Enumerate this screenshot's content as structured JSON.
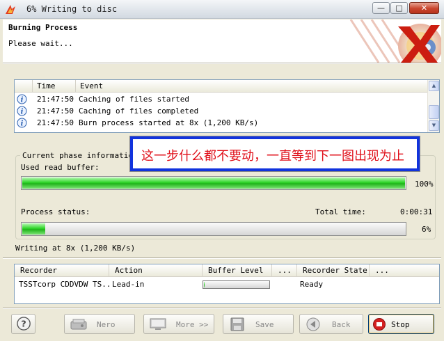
{
  "window": {
    "title": "6% Writing to disc"
  },
  "header": {
    "title": "Burning Process",
    "subtitle": "Please wait..."
  },
  "log": {
    "columns": [
      "Time",
      "Event"
    ],
    "rows": [
      {
        "time": "21:47:50",
        "event": "Caching of files started"
      },
      {
        "time": "21:47:50",
        "event": "Caching of files completed"
      },
      {
        "time": "21:47:50",
        "event": "Burn process started at 8x (1,200 KB/s)"
      }
    ]
  },
  "phase": {
    "legend": "Current phase information",
    "read_buffer_label": "Used read buffer:",
    "read_buffer_percent_text": "100%",
    "read_buffer_fraction": 1.0,
    "process_label": "Process status:",
    "total_time_label": "Total time:",
    "total_time": "0:00:31",
    "process_percent_text": "6%",
    "process_fraction": 0.06
  },
  "writing_status": "Writing at 8x (1,200 KB/s)",
  "annotation": "这一步什么都不要动，一直等到下一图出现为止",
  "recorders": {
    "columns": [
      "Recorder",
      "Action",
      "Buffer Level",
      "...",
      "Recorder State",
      "..."
    ],
    "rows": [
      {
        "recorder": "TSSTcorp CDDVDW TS...",
        "action": "Lead-in",
        "buffer_fraction": 0.01,
        "state": "Ready"
      }
    ]
  },
  "buttons": {
    "help": "?",
    "nero": "Nero",
    "more": "More >>",
    "save": "Save",
    "back": "Back",
    "stop": "Stop"
  },
  "colors": {
    "progress": "#2fd62a",
    "annotation_border": "#1133dd",
    "annotation_text": "#e0101a",
    "stop_icon": "#d42020"
  }
}
